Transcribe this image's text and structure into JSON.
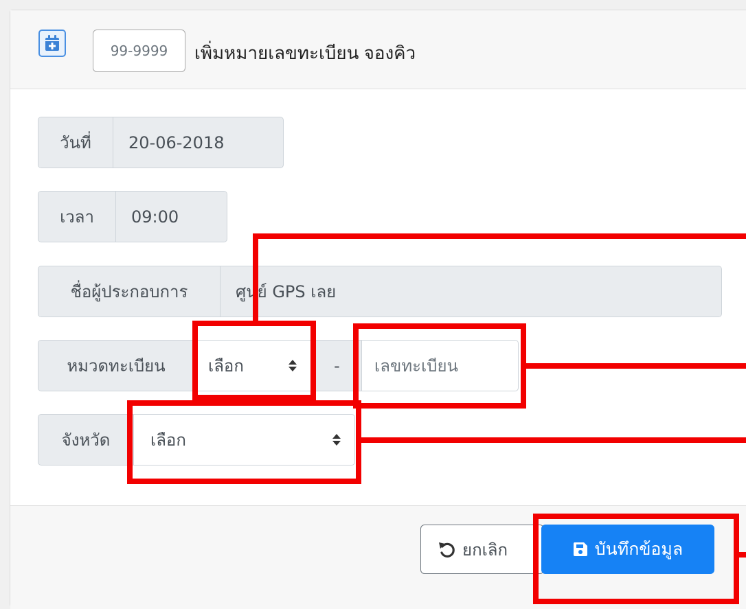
{
  "header": {
    "calendar_icon": "calendar-plus-icon",
    "plate_format": "99-9999",
    "title": "เพิ่มหมายเลขทะเบียน จองคิว"
  },
  "form": {
    "date": {
      "label": "วันที่",
      "value": "20-06-2018"
    },
    "time": {
      "label": "เวลา",
      "value": "09:00"
    },
    "operator": {
      "label": "ชื่อผู้ประกอบการ",
      "value": "ศูนย์ GPS เลย"
    },
    "plate": {
      "label": "หมวดทะเบียน",
      "category_select": "เลือก",
      "separator": "-",
      "number_placeholder": "เลขทะเบียน"
    },
    "province": {
      "label": "จังหวัด",
      "select": "เลือก"
    }
  },
  "footer": {
    "cancel_label": "ยกเลิก",
    "cancel_icon": "undo-icon",
    "save_label": "บันทึกข้อมูล",
    "save_icon": "floppy-disk-icon"
  },
  "colors": {
    "primary": "#1682f5",
    "annotation_red": "#f20000",
    "addon_bg": "#e9ecef"
  }
}
